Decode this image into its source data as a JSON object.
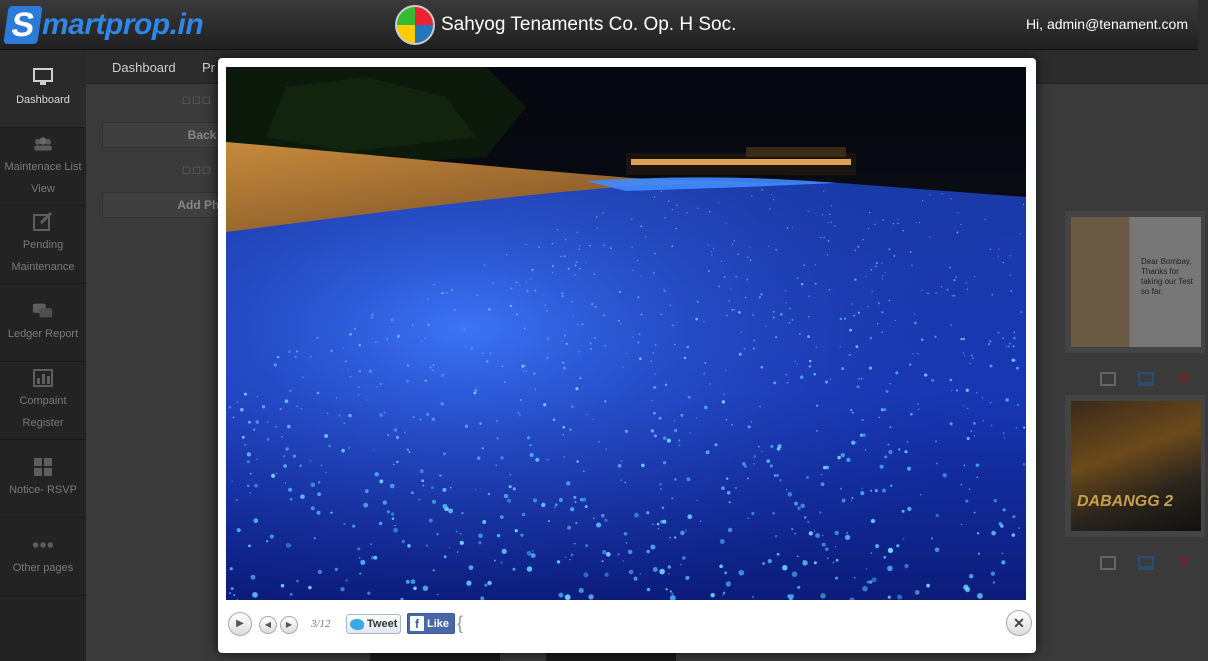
{
  "header": {
    "logo_s": "S",
    "logo_rest": "martprop.in",
    "society_name": "Sahyog Tenaments Co. Op. H Soc.",
    "user_greeting": "Hi, admin@tenament.com"
  },
  "sidebar": {
    "items": [
      {
        "label": "Dashboard",
        "icon": "monitor-icon"
      },
      {
        "label": "Maintenace List View",
        "icon": "users-icon"
      },
      {
        "label": "Pending Maintenance",
        "icon": "edit-icon"
      },
      {
        "label": "Ledger Report",
        "icon": "chat-icon"
      },
      {
        "label": "Compaint Register",
        "icon": "bar-chart-icon"
      },
      {
        "label": "Notice- RSVP",
        "icon": "grid-icon"
      },
      {
        "label": "Other pages",
        "icon": "dots-icon"
      }
    ]
  },
  "breadcrumbs": [
    "Dashboard",
    "Pr"
  ],
  "background": {
    "back_button": "Back",
    "add_photo_button": "Add Pho",
    "thumb1_caption": "Dear Bombay, Thanks for taking our Test so far.",
    "thumb2_caption": "DABANGG 2"
  },
  "lightbox": {
    "counter": "3/12",
    "tweet_label": "Tweet",
    "like_label": "Like",
    "fb_letter": "f",
    "play_symbol": "▶",
    "prev_symbol": "◀",
    "next_symbol": "▶",
    "close_symbol": "✕",
    "bracket": "{"
  },
  "colors": {
    "brand_blue": "#2f87ea",
    "glow_blue": "#2a7dff",
    "sand": "#c78a3c"
  }
}
